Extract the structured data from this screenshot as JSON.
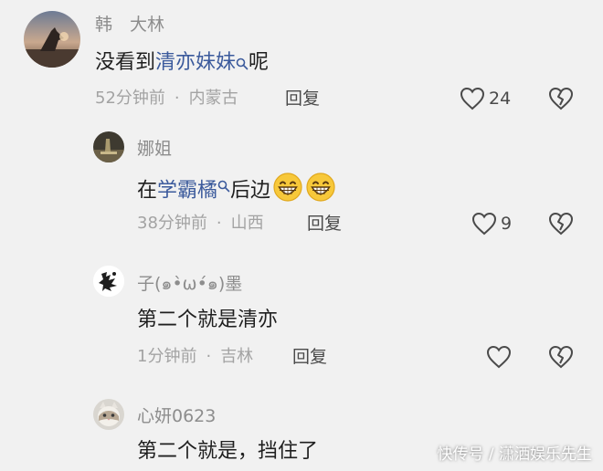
{
  "comments": [
    {
      "username": "韩　大林",
      "text_prefix": "没看到",
      "link_text": "清亦妹妹",
      "text_suffix": "呢",
      "time": "52分钟前",
      "location": "内蒙古",
      "reply_label": "回复",
      "likes": "24"
    },
    {
      "username": "娜姐",
      "text_prefix": "在",
      "link_text": "学霸橘",
      "text_suffix": "后边",
      "time": "38分钟前",
      "location": "山西",
      "reply_label": "回复",
      "likes": "9"
    },
    {
      "username": "子(๑•̀ω•́๑)墨",
      "text": "第二个就是清亦",
      "time": "1分钟前",
      "location": "吉林",
      "reply_label": "回复"
    },
    {
      "username": "心妍0623",
      "text": "第二个就是，挡住了"
    }
  ],
  "watermark": "快传号 / 潇洒娱乐先生",
  "icons": {
    "like": "heart-outline-icon",
    "dislike": "broken-heart-icon",
    "search": "search-icon"
  }
}
